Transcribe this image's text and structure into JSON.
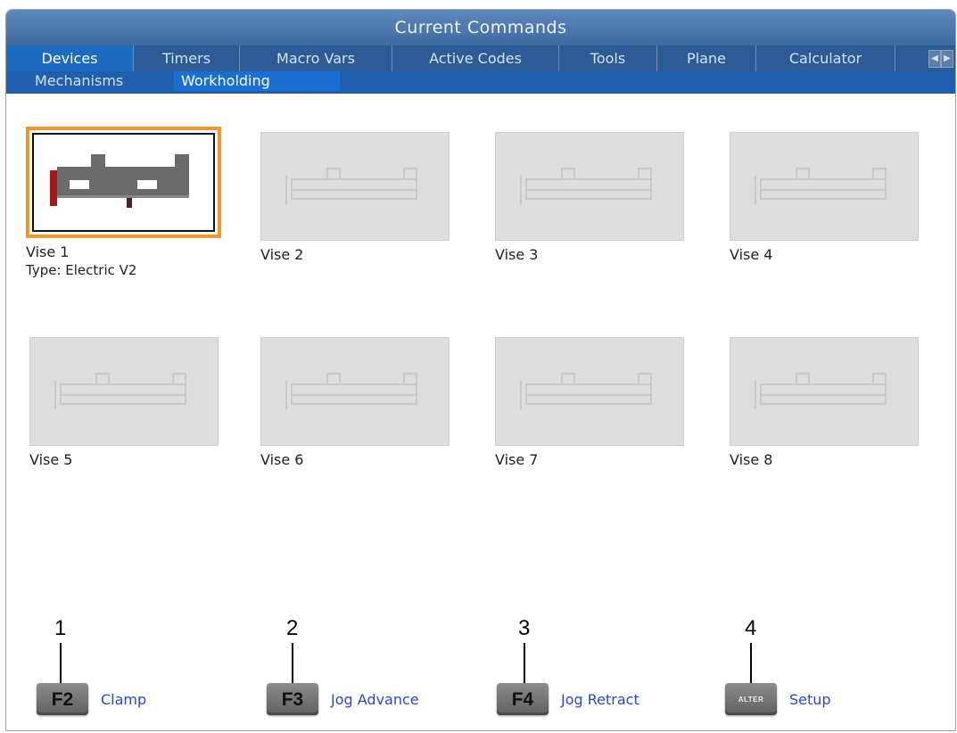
{
  "window": {
    "title": "Current Commands"
  },
  "tabs": [
    {
      "label": "Devices",
      "active": true
    },
    {
      "label": "Timers",
      "active": false
    },
    {
      "label": "Macro Vars",
      "active": false
    },
    {
      "label": "Active Codes",
      "active": false
    },
    {
      "label": "Tools",
      "active": false
    },
    {
      "label": "Plane",
      "active": false
    },
    {
      "label": "Calculator",
      "active": false
    }
  ],
  "subtabs": [
    {
      "label": "Mechanisms",
      "active": false
    },
    {
      "label": "Workholding",
      "active": true
    }
  ],
  "vises": [
    {
      "name": "Vise 1",
      "type": "Type: Electric V2",
      "selected": true
    },
    {
      "name": "Vise 2",
      "type": "",
      "selected": false
    },
    {
      "name": "Vise 3",
      "type": "",
      "selected": false
    },
    {
      "name": "Vise 4",
      "type": "",
      "selected": false
    },
    {
      "name": "Vise 5",
      "type": "",
      "selected": false
    },
    {
      "name": "Vise 6",
      "type": "",
      "selected": false
    },
    {
      "name": "Vise 7",
      "type": "",
      "selected": false
    },
    {
      "name": "Vise 8",
      "type": "",
      "selected": false
    }
  ],
  "function_keys": [
    {
      "key": "F2",
      "label": "Clamp",
      "callout": "1"
    },
    {
      "key": "F3",
      "label": "Jog Advance",
      "callout": "2"
    },
    {
      "key": "F4",
      "label": "Jog Retract",
      "callout": "3"
    },
    {
      "key": "ALTER",
      "label": "Setup",
      "callout": "4"
    }
  ],
  "colors": {
    "title_bar": "#4a76ad",
    "tab_bar": "#2d5b95",
    "active_tab": "#1d6bc0",
    "selection_border": "#f0962e",
    "key_label": "#2b47d1"
  }
}
